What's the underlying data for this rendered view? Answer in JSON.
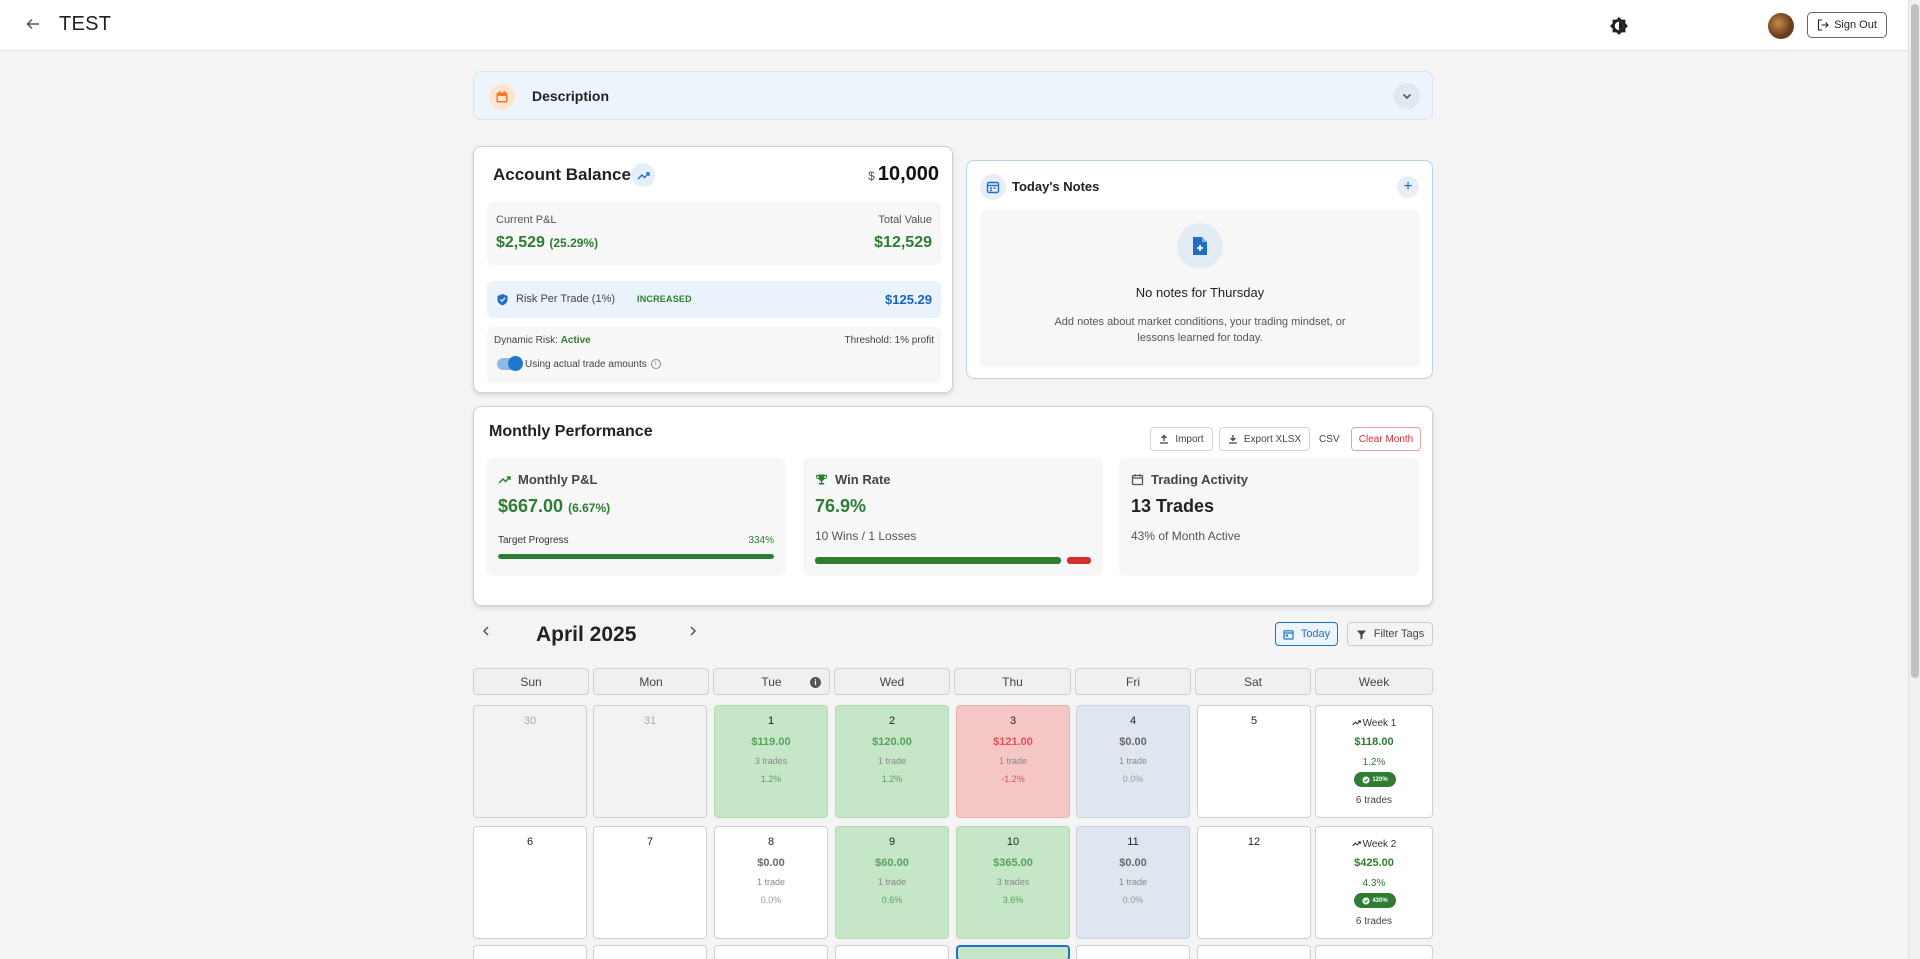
{
  "header": {
    "title": "TEST",
    "sign_out_label": "Sign Out",
    "icons": [
      "arrow-left-icon",
      "contrast-icon",
      "avatar",
      "logout-icon"
    ]
  },
  "description": {
    "title": "Description"
  },
  "account": {
    "title": "Account Balance",
    "currency": "$",
    "balance": "10,000",
    "current_pnl_label": "Current P&L",
    "current_pnl_value": "$2,529",
    "current_pnl_pct": "(25.29%)",
    "total_value_label": "Total Value",
    "total_value": "$12,529",
    "risk_label": "Risk Per Trade (1%)",
    "risk_badge": "INCREASED",
    "risk_value": "$125.29",
    "dynamic_risk_label": "Dynamic Risk:",
    "dynamic_risk_status": "Active",
    "threshold": "Threshold: 1% profit",
    "toggle_label": "Using actual trade amounts",
    "toggle_on": true
  },
  "notes": {
    "title": "Today's Notes",
    "empty_title": "No notes for Thursday",
    "empty_desc": "Add notes about market conditions, your trading mindset, or lessons learned for today."
  },
  "monthly": {
    "title": "Monthly Performance",
    "buttons": {
      "import": "Import",
      "export": "Export XLSX",
      "csv": "CSV",
      "clear": "Clear Month"
    },
    "pnl": {
      "label": "Monthly P&L",
      "value": "$667.00",
      "pct": "(6.67%)",
      "target_label": "Target Progress",
      "target_pct": "334%",
      "target_fill": 1.0
    },
    "win_rate": {
      "label": "Win Rate",
      "value": "76.9%",
      "sub": "10 Wins / 1 Losses",
      "wins": 10,
      "losses": 1
    },
    "activity": {
      "label": "Trading Activity",
      "value": "13 Trades",
      "sub": "43% of Month Active"
    }
  },
  "calendar": {
    "month": "April 2025",
    "today_label": "Today",
    "filter_label": "Filter Tags",
    "headers": [
      "Sun",
      "Mon",
      "Tue",
      "Wed",
      "Thu",
      "Fri",
      "Sat",
      "Week"
    ],
    "rows": [
      {
        "days": [
          {
            "day": "30",
            "type": "out"
          },
          {
            "day": "31",
            "type": "out"
          },
          {
            "day": "1",
            "type": "win",
            "amount": "$119.00",
            "trades": "3 trades",
            "pct": "1.2%"
          },
          {
            "day": "2",
            "type": "win",
            "amount": "$120.00",
            "trades": "1 trade",
            "pct": "1.2%"
          },
          {
            "day": "3",
            "type": "loss",
            "amount": "$121.00",
            "trades": "1 trade",
            "pct": "-1.2%"
          },
          {
            "day": "4",
            "type": "flat",
            "amount": "$0.00",
            "trades": "1 trade",
            "pct": "0.0%"
          },
          {
            "day": "5",
            "type": "empty"
          }
        ],
        "week": {
          "label": "Week 1",
          "amount": "$118.00",
          "pct": "1.2%",
          "badge": "120%",
          "trades": "6 trades"
        }
      },
      {
        "days": [
          {
            "day": "6",
            "type": "empty"
          },
          {
            "day": "7",
            "type": "empty"
          },
          {
            "day": "8",
            "type": "empty",
            "amount": "$0.00",
            "trades": "1 trade",
            "pct": "0.0%"
          },
          {
            "day": "9",
            "type": "win",
            "amount": "$60.00",
            "trades": "1 trade",
            "pct": "0.6%"
          },
          {
            "day": "10",
            "type": "win",
            "amount": "$365.00",
            "trades": "3 trades",
            "pct": "3.6%"
          },
          {
            "day": "11",
            "type": "flat",
            "amount": "$0.00",
            "trades": "1 trade",
            "pct": "0.0%"
          },
          {
            "day": "12",
            "type": "empty"
          }
        ],
        "week": {
          "label": "Week 2",
          "amount": "$425.00",
          "pct": "4.3%",
          "badge": "430%",
          "trades": "6 trades"
        }
      }
    ]
  },
  "colors": {
    "accent": "#1e6fc8",
    "profit": "#2e7d32",
    "loss": "#d32f2f"
  }
}
